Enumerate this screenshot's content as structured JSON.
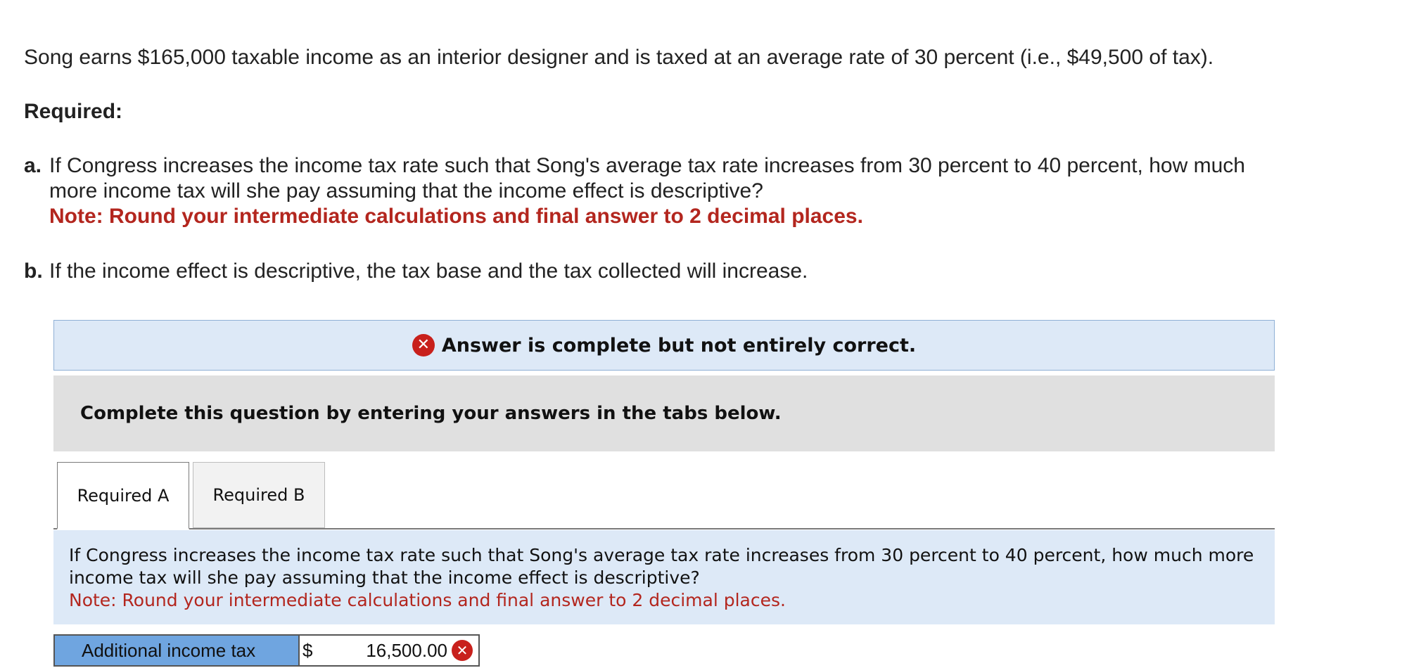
{
  "problem": {
    "intro": "Song earns $165,000 taxable income as an interior designer and is taxed at an average rate of 30 percent (i.e., $49,500 of tax).",
    "required_heading": "Required:",
    "question_a": {
      "letter": "a.",
      "line1": "If Congress increases the income tax rate such that Song's average tax rate increases from 30 percent to 40 percent, how much",
      "line2": "more income tax will she pay assuming that the income effect is descriptive?",
      "note": "Note: Round your intermediate calculations and final answer to 2 decimal places."
    },
    "question_b": {
      "letter": "b.",
      "text": "If the income effect is descriptive, the tax base and the tax collected will increase."
    }
  },
  "result_banner": {
    "icon": "x-circle-icon",
    "text": "Answer is complete but not entirely correct."
  },
  "instructions": {
    "text": "Complete this question by entering your answers in the tabs below."
  },
  "tabs": [
    {
      "label": "Required A",
      "active": true
    },
    {
      "label": "Required B",
      "active": false
    }
  ],
  "panel": {
    "text": "If Congress increases the income tax rate such that Song's average tax rate increases from 30 percent to 40 percent, how much more income tax will she pay assuming that the income effect is descriptive?",
    "note": "Note: Round your intermediate calculations and final answer to 2 decimal places."
  },
  "answer": {
    "label": "Additional income tax",
    "currency": "$",
    "value": "16,500.00",
    "status_icon": "x-circle-icon"
  },
  "colors": {
    "error_red": "#c8201c",
    "note_red": "#b3261e",
    "banner_bg": "#dde9f7",
    "label_blue": "#6fa5e0"
  }
}
